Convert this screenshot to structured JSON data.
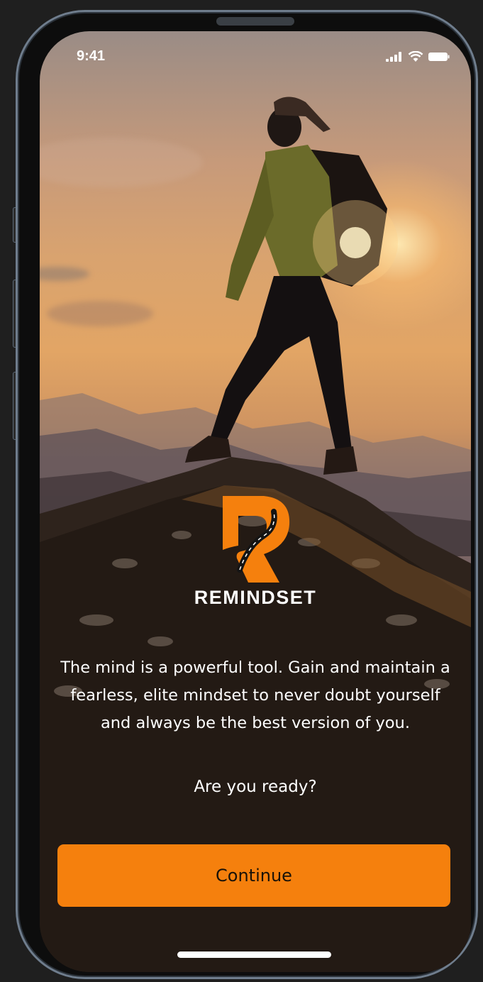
{
  "status_bar": {
    "time": "9:41",
    "signal_icon": "cellular-signal-icon",
    "wifi_icon": "wifi-icon",
    "battery_icon": "battery-icon"
  },
  "brand": {
    "logo_icon": "remindset-r-logo",
    "name": "REMINDSET",
    "accent_color": "#f5800d"
  },
  "content": {
    "tagline": "The mind is a powerful tool. Gain and maintain a fearless, elite mindset to never doubt yourself and always be the best version of you.",
    "question": "Are you ready?"
  },
  "actions": {
    "continue_label": "Continue"
  },
  "background": {
    "image": "hiker-on-mountain-peak-at-sunset"
  }
}
